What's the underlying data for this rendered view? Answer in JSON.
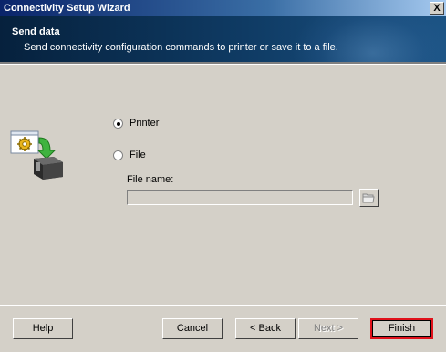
{
  "window": {
    "title": "Connectivity Setup Wizard",
    "close_glyph": "X"
  },
  "banner": {
    "title": "Send data",
    "description": "Send connectivity configuration commands to printer or save it to a file."
  },
  "options": {
    "printer_label": "Printer",
    "file_label": "File",
    "selected": "Printer"
  },
  "file": {
    "name_label": "File name:",
    "name_value": ""
  },
  "buttons": {
    "help": "Help",
    "cancel": "Cancel",
    "back": "< Back",
    "next": "Next >",
    "finish": "Finish"
  },
  "icons": {
    "wizard": "printer-config-icon",
    "browse": "folder-browse-icon"
  }
}
